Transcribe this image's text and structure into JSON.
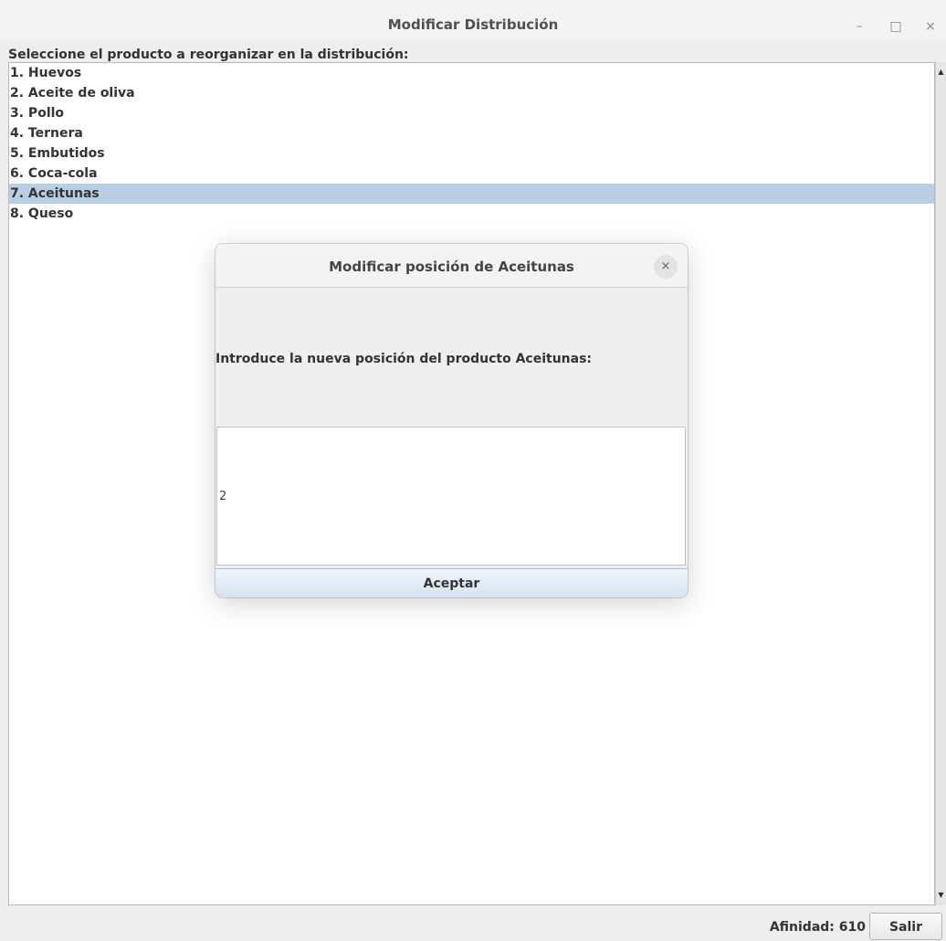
{
  "window": {
    "title": "Modificar Distribución",
    "minimize_glyph": "–",
    "maximize_glyph": "□",
    "close_glyph": "×"
  },
  "main": {
    "prompt": "Seleccione el producto a reorganizar en la distribución:",
    "products": [
      "1. Huevos",
      "2. Aceite de oliva",
      "3. Pollo",
      "4. Ternera",
      "5. Embutidos",
      "6. Coca-cola",
      "7. Aceitunas",
      "8. Queso"
    ],
    "selected_index": 6
  },
  "footer": {
    "affinity": "Afinidad: 610",
    "exit_label": "Salir"
  },
  "dialog": {
    "title": "Modificar posición de Aceitunas",
    "message": "Introduce la nueva posición del producto Aceitunas:",
    "input_value": "2",
    "accept_label": "Aceptar",
    "close_glyph": "×"
  },
  "colors": {
    "selection": "#b8cfe5",
    "background": "#eeeeee"
  }
}
